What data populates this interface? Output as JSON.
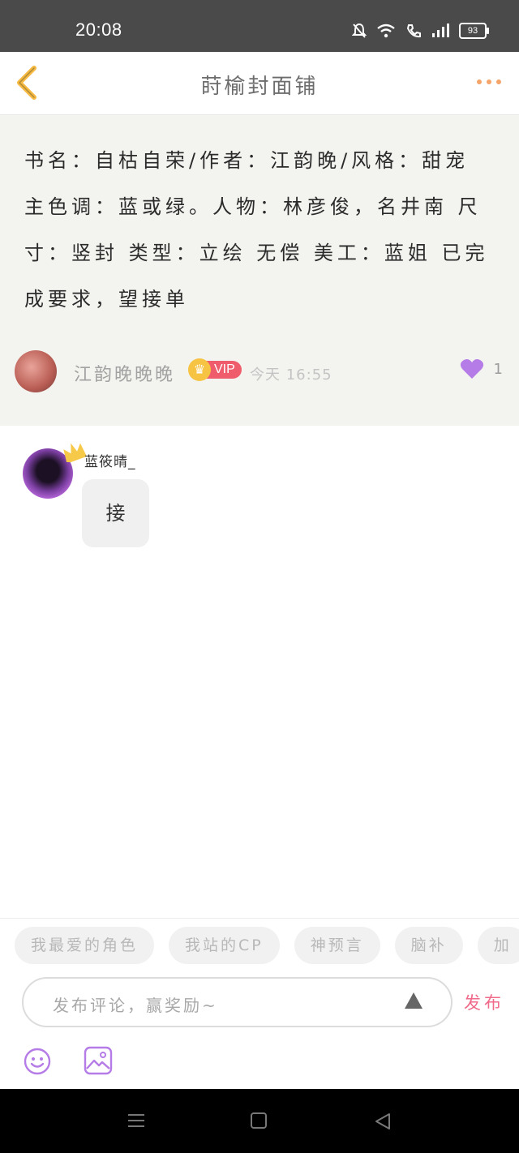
{
  "status_bar": {
    "time": "20:08",
    "battery": "93"
  },
  "header": {
    "title": "莳榆封面铺"
  },
  "post": {
    "text": "书名：自枯自荣/作者：江韵晚/风格：甜宠 主色调：蓝或绿。人物：林彦俊，名井南 尺寸：竖封 类型：立绘 无偿 美工：蓝姐 已完成要求，望接单",
    "author": "江韵晚晚晚",
    "vip": "VIP",
    "time": "今天 16:55",
    "likes": "1"
  },
  "comment": {
    "name": "蓝筱晴_",
    "text": "接"
  },
  "chips": [
    "我最爱的角色",
    "我站的CP",
    "神预言",
    "脑补",
    "加"
  ],
  "composer": {
    "placeholder": "发布评论，赢奖励~",
    "send_label": "发布"
  },
  "colors": {
    "accent": "#f06a8a",
    "like": "#b57be6",
    "back": "#f5b942",
    "vip": "#ef5d6d"
  },
  "icons": [
    "back-icon",
    "more-icon",
    "like-icon",
    "vip-crown-icon",
    "emoji-icon",
    "image-icon",
    "send-triangle-icon"
  ]
}
